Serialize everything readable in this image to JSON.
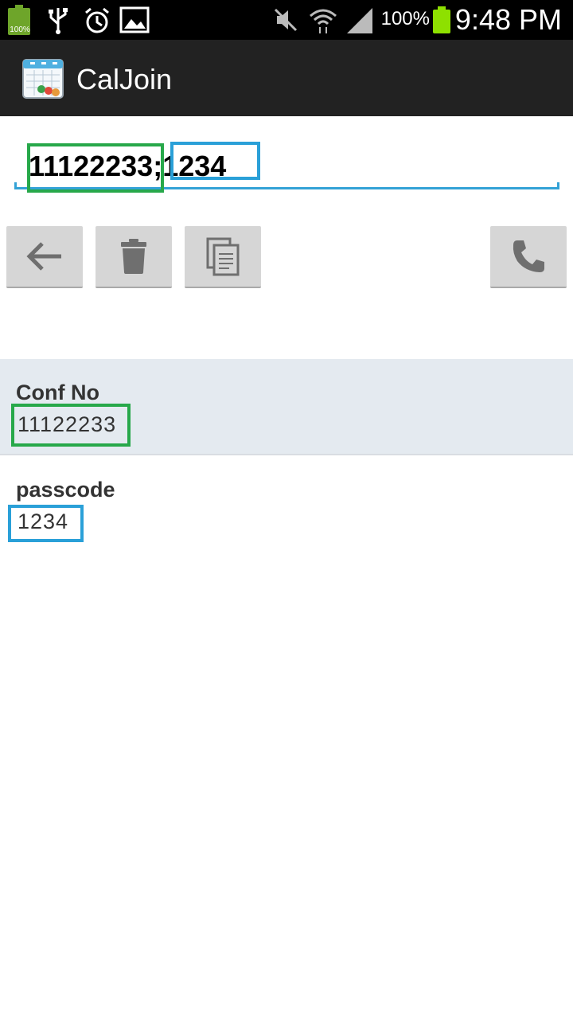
{
  "status_bar": {
    "battery_small_pct": "100%",
    "signal_pct": "100%",
    "time": "9:48 PM",
    "icons": [
      "battery-icon",
      "usb-icon",
      "alarm-icon",
      "image-icon",
      "mute-icon",
      "wifi-icon",
      "signal-icon",
      "battery-icon"
    ]
  },
  "action_bar": {
    "title": "CalJoin",
    "icon": "calendar-app-icon"
  },
  "dial_input": {
    "value": "11122233;1234"
  },
  "toolbar": {
    "back_icon": "arrow-left-icon",
    "delete_icon": "trash-icon",
    "copy_icon": "copy-icon",
    "call_icon": "phone-icon"
  },
  "fields": [
    {
      "label": "Conf No",
      "value": "11122233"
    },
    {
      "label": "passcode",
      "value": "1234"
    }
  ],
  "colors": {
    "highlight_green": "#27a84a",
    "highlight_blue": "#2aa0d8",
    "accent_line": "#33a2d6",
    "selected_row": "#e4eaf0"
  }
}
